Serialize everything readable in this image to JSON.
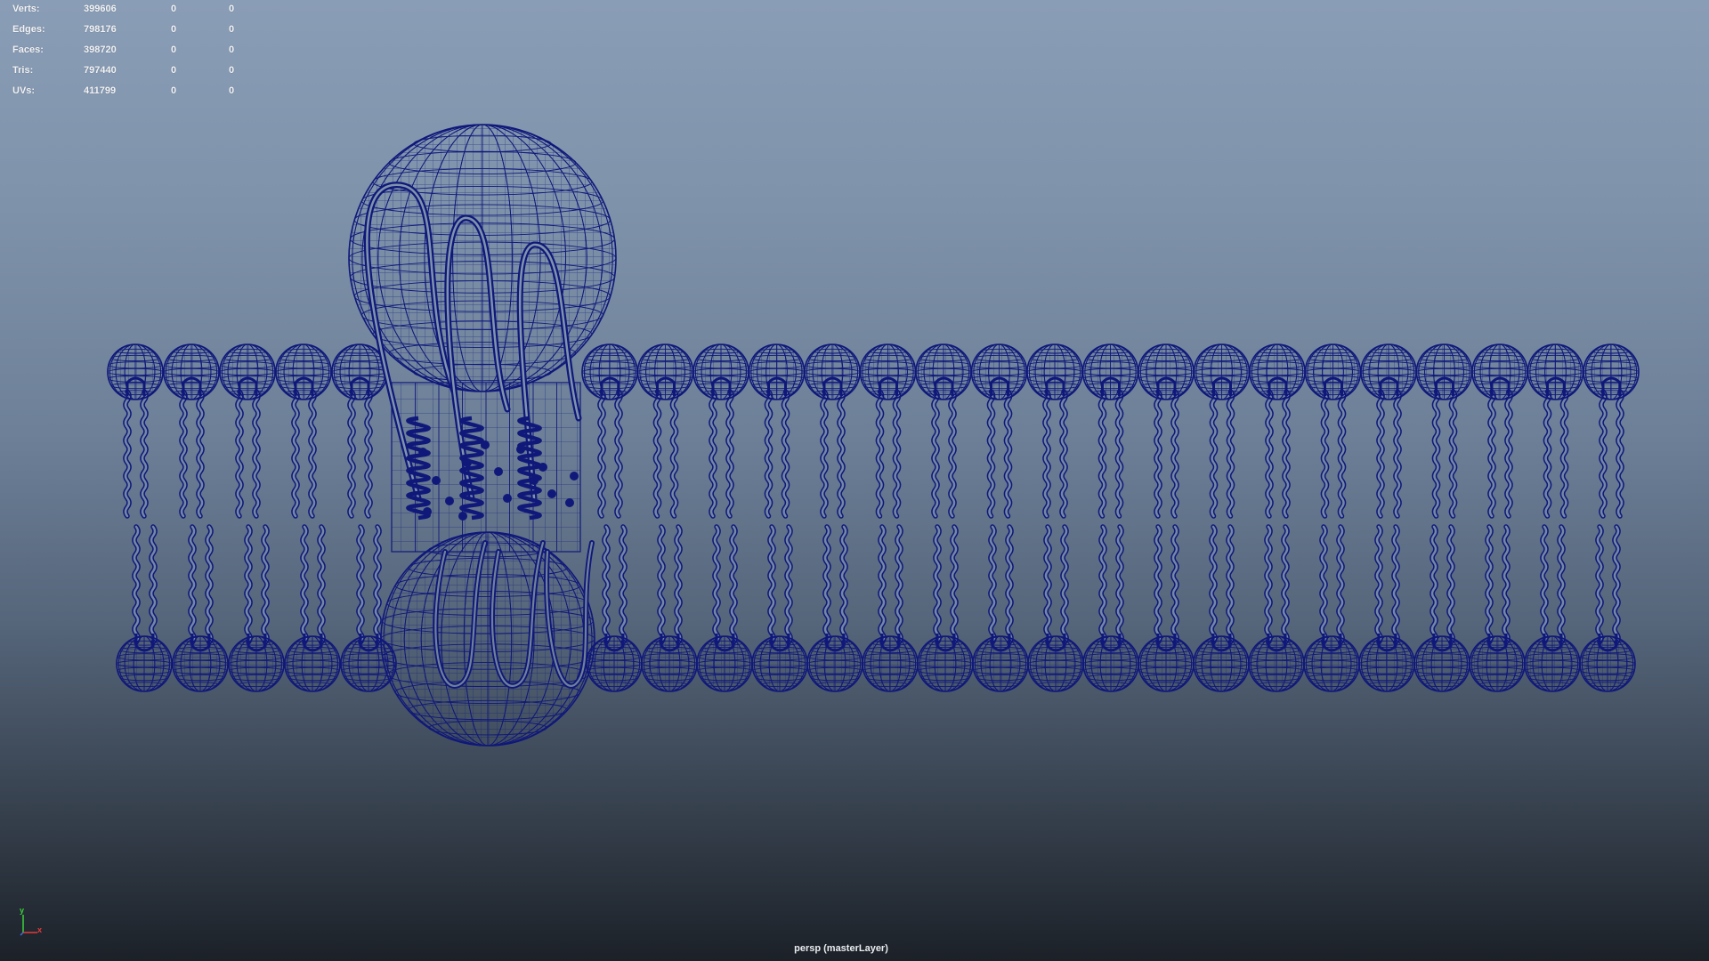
{
  "hud": {
    "rows": [
      {
        "label": "Verts:",
        "total": "399606",
        "selected": "0",
        "components": "0"
      },
      {
        "label": "Edges:",
        "total": "798176",
        "selected": "0",
        "components": "0"
      },
      {
        "label": "Faces:",
        "total": "398720",
        "selected": "0",
        "components": "0"
      },
      {
        "label": "Tris:",
        "total": "797440",
        "selected": "0",
        "components": "0"
      },
      {
        "label": "UVs:",
        "total": "411799",
        "selected": "0",
        "components": "0"
      }
    ]
  },
  "viewport": {
    "camera_label": "persp (masterLayer)",
    "wireframe_color": "#10187a",
    "background_top": "#8a9db6",
    "background_bottom": "#1c2128"
  },
  "axis_gizmo": {
    "y_label": "y",
    "x_label": "x",
    "y_color": "#3bd23b",
    "x_color": "#e23a3a",
    "z_color": "#3a6ee2"
  }
}
